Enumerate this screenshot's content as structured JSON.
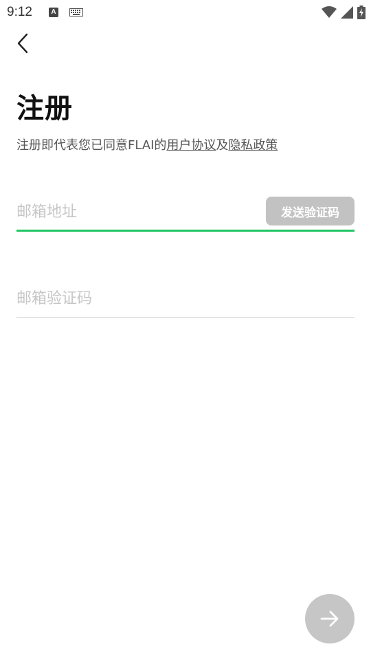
{
  "status_bar": {
    "time": "9:12",
    "notification_a": "A"
  },
  "page": {
    "title": "注册",
    "agreement_prefix": "注册即代表您已同意FLAI的",
    "user_agreement_link": "用户协议",
    "agreement_connector": "及",
    "privacy_policy_link": "隐私政策"
  },
  "email_field": {
    "value": "",
    "placeholder": "邮箱地址",
    "send_code_label": "发送验证码"
  },
  "code_field": {
    "value": "",
    "placeholder": "邮箱验证码"
  },
  "icons": {
    "back": "back-arrow-icon",
    "next": "arrow-right-icon",
    "wifi": "wifi-icon",
    "signal": "signal-icon",
    "battery": "battery-charging-icon",
    "keyboard": "keyboard-icon"
  },
  "colors": {
    "accent_green": "#1fc562",
    "disabled_gray": "#c2c2c2",
    "placeholder_gray": "#c6c6c6"
  }
}
